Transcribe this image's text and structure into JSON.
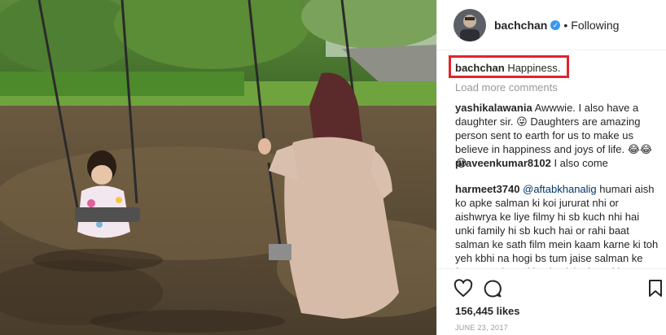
{
  "post": {
    "photo_description_icon": "photo-mother-daughter-swings",
    "header": {
      "username": "bachchan",
      "verified_icon": "verified-badge-icon",
      "separator": "•",
      "follow_status": "Following"
    },
    "caption": {
      "username": "bachchan",
      "text": "Happiness."
    },
    "load_more": "Load more comments",
    "comments": [
      {
        "username": "yashikalawania",
        "text": "Awwwie. I also have a daughter sir. 😜 Daughters are amazing person sent to earth for us to make us believe in happiness and joys of life. 😂😂😂"
      },
      {
        "username": "praveenkumar8102",
        "text": "I also come"
      },
      {
        "username": "harmeet3740",
        "mention": "@aftabkhanalig",
        "text": "humari aish ko apke salman ki koi jururat nhi or aishwrya ke liye filmy hi sb kuch nhi hai unki family hi sb kuch hai or rahi baat salman ke sath film mein kaam karne ki toh yeh kbhi na hogi bs tum jaise salman ke fans or salman ki yeh wish ab puri hone se rahi"
      }
    ],
    "likes": "156,445 likes",
    "date": "JUNE 23, 2017"
  },
  "colors": {
    "highlight_box": "#e0242e",
    "verified": "#3897f0",
    "secondary_text": "#999999"
  }
}
